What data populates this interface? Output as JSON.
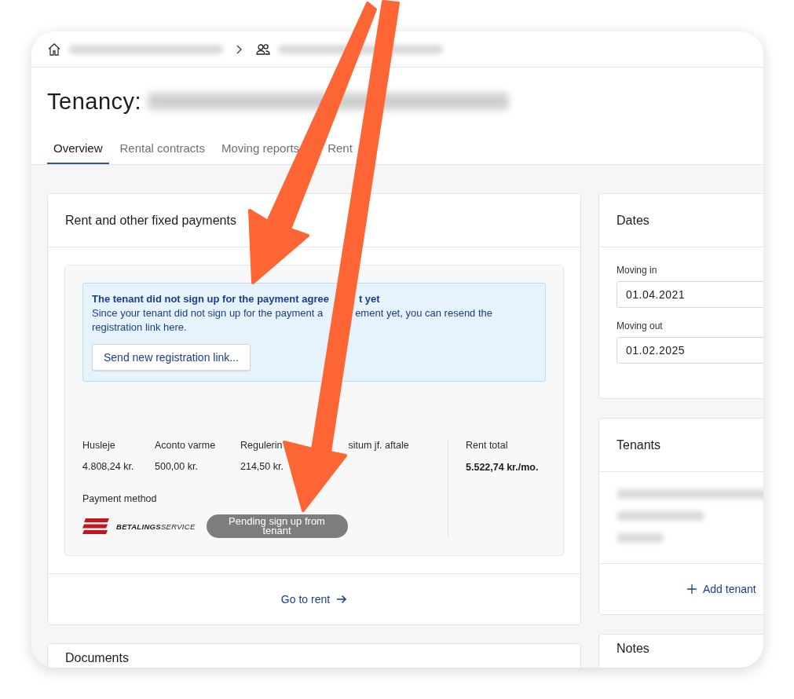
{
  "title": "Tenancy:",
  "tabs": [
    {
      "label": "Overview",
      "selected": true
    },
    {
      "label": "Rental contracts",
      "selected": false
    },
    {
      "label": "Moving reports",
      "selected": false
    },
    {
      "label": "Rent",
      "selected": false
    }
  ],
  "rent_card": {
    "title": "Rent and other fixed payments",
    "notice": {
      "title_parts": [
        "The tenant did not sign up for the payment agree",
        "t yet"
      ],
      "body_lines": [
        [
          "Since your tenant did not sign up for the payment a",
          "ement yet, you can resend the"
        ],
        [
          "registration link here."
        ]
      ],
      "button": "Send new registration link..."
    },
    "items": [
      {
        "label_parts": [
          "Husleje"
        ],
        "value": "4.808,24 kr."
      },
      {
        "label_parts": [
          "Aconto varme"
        ],
        "value": "500,00 kr."
      },
      {
        "label_parts": [
          "Regulerin",
          "situm jf. aftale"
        ],
        "value": "214,50 kr."
      }
    ],
    "total": {
      "label": "Rent total",
      "value": "5.522,74 kr./mo."
    },
    "payment_method": {
      "label": "Payment method",
      "logo_text": "**BETALINGS**SERVICE",
      "status": "Pending sign up from tenant"
    },
    "link": "Go to rent"
  },
  "dates_card": {
    "title": "Dates",
    "fields": [
      {
        "label": "Moving in",
        "value": "01.04.2021"
      },
      {
        "label": "Moving out",
        "value": "01.02.2025"
      }
    ]
  },
  "tenants_card": {
    "title": "Tenants",
    "add_button": "Add tenant"
  },
  "documents_card": {
    "title": "Documents"
  },
  "notes_card": {
    "title": "Notes"
  }
}
